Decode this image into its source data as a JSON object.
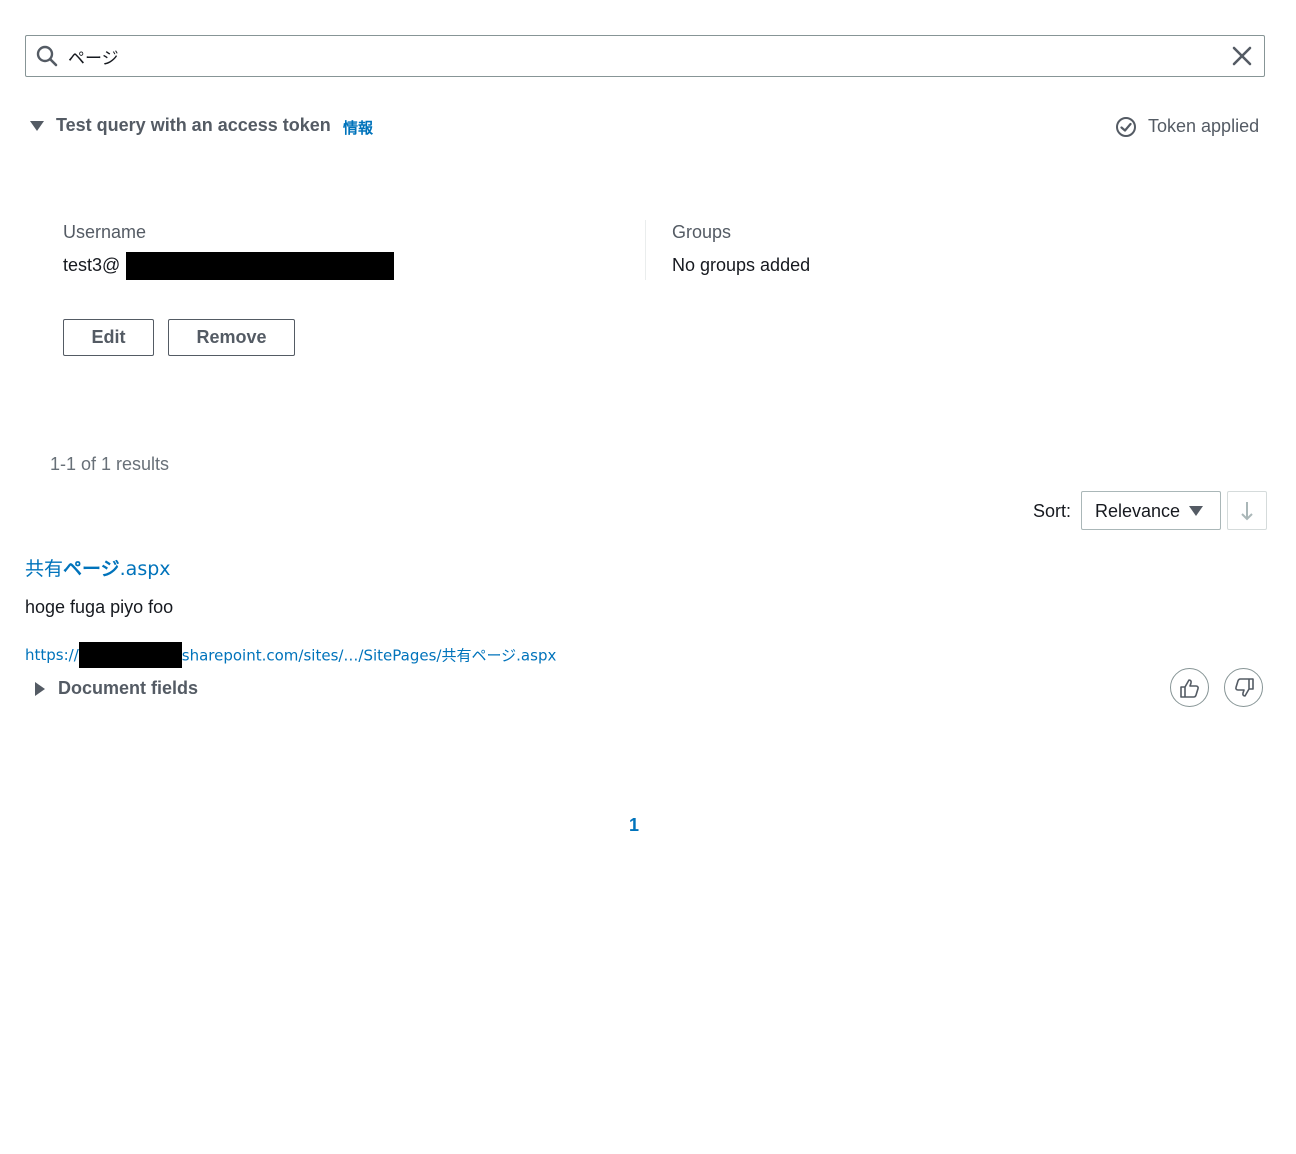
{
  "search": {
    "value": "ページ",
    "icon": "search-icon",
    "clear_icon": "close-icon"
  },
  "token_section": {
    "title": "Test query with an access token",
    "info_link": "情報",
    "status": "Token applied",
    "status_icon": "check-circle-icon",
    "username_label": "Username",
    "username_value": "test3@",
    "groups_label": "Groups",
    "groups_value": "No groups added",
    "edit_label": "Edit",
    "remove_label": "Remove"
  },
  "results": {
    "count_text": "1-1 of 1 results",
    "sort_label": "Sort:",
    "sort_value": "Relevance",
    "sort_direction_icon": "arrow-down-icon",
    "items": [
      {
        "title_prefix": "共有",
        "title_highlight": "ページ",
        "title_suffix": ".aspx",
        "excerpt": "hoge fuga piyo foo",
        "url_prefix": "https://",
        "url_suffix": "sharepoint.com/sites/…/SitePages/共有ページ.aspx",
        "fields_label": "Document fields"
      }
    ]
  },
  "pagination": {
    "current_page": "1"
  },
  "colors": {
    "link": "#0073bb",
    "text": "#16191f",
    "muted": "#545b64",
    "border": "#879596"
  }
}
